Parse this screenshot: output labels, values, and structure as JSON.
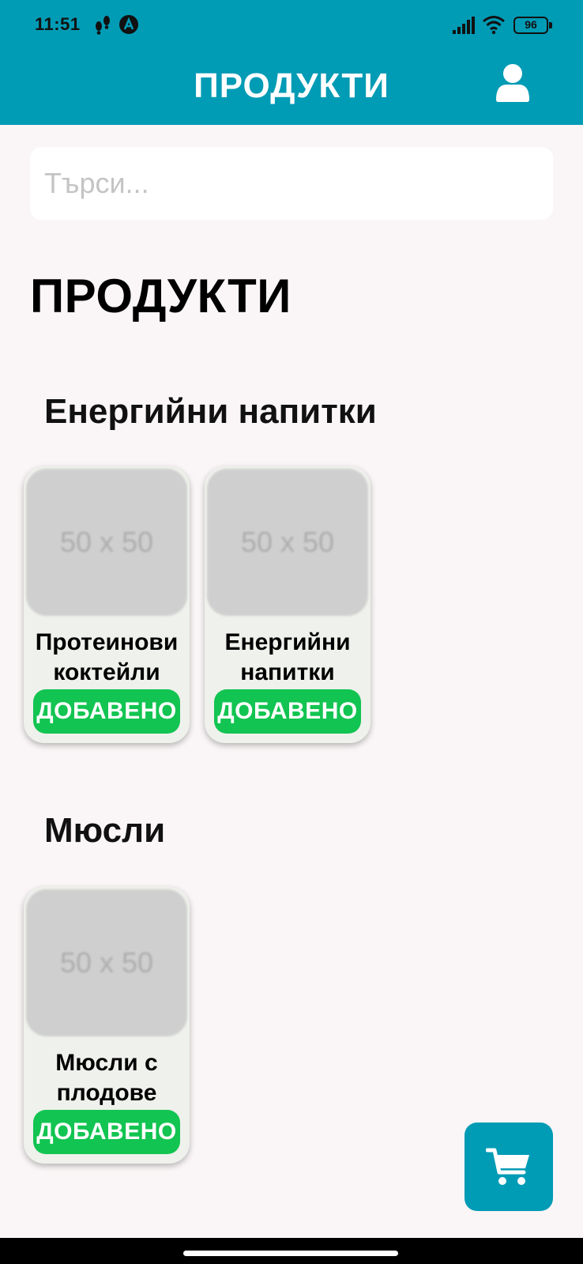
{
  "status_bar": {
    "time": "11:51",
    "battery": "96",
    "icons": [
      "steps-icon",
      "a-badge-icon",
      "signal-icon",
      "wifi-icon",
      "battery-icon"
    ]
  },
  "header": {
    "title": "ПРОДУКТИ",
    "user_icon": "user-icon"
  },
  "search": {
    "placeholder": "Търси..."
  },
  "page_heading": "ПРОДУКТИ",
  "sections": [
    {
      "title": "Енергийни напитки",
      "products": [
        {
          "image_text": "50 x 50",
          "name": "Протеинови коктейли",
          "button": "ДОБАВЕНО"
        },
        {
          "image_text": "50 x 50",
          "name": "Енергийни напитки",
          "button": "ДОБАВЕНО"
        }
      ]
    },
    {
      "title": "Мюсли",
      "products": [
        {
          "image_text": "50 x 50",
          "name": "Мюсли с плодове",
          "button": "ДОБАВЕНО"
        }
      ]
    }
  ],
  "colors": {
    "header": "#009bb5",
    "added_button": "#12c451",
    "background": "#faf6f7",
    "card": "#eff1ec"
  },
  "fab": {
    "icon": "cart-icon"
  }
}
